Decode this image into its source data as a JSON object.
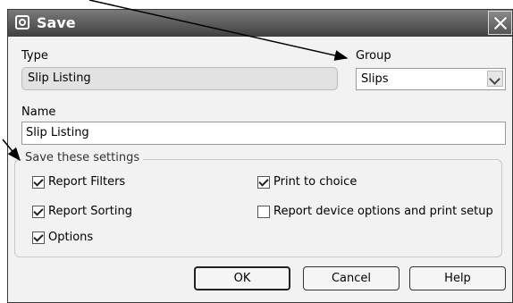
{
  "dialog": {
    "title": "Save",
    "type_label": "Type",
    "type_value": "Slip Listing",
    "group_label": "Group",
    "group_value": "Slips",
    "name_label": "Name",
    "name_value": "Slip Listing",
    "settings_legend": "Save these settings",
    "checkboxes": [
      {
        "label": "Report Filters",
        "checked": true
      },
      {
        "label": "Report Sorting",
        "checked": true
      },
      {
        "label": "Options",
        "checked": true
      },
      {
        "label": "Print to choice",
        "checked": true
      },
      {
        "label": "Report device options and print setup",
        "checked": false
      }
    ],
    "buttons": {
      "ok": "OK",
      "cancel": "Cancel",
      "help": "Help"
    }
  }
}
